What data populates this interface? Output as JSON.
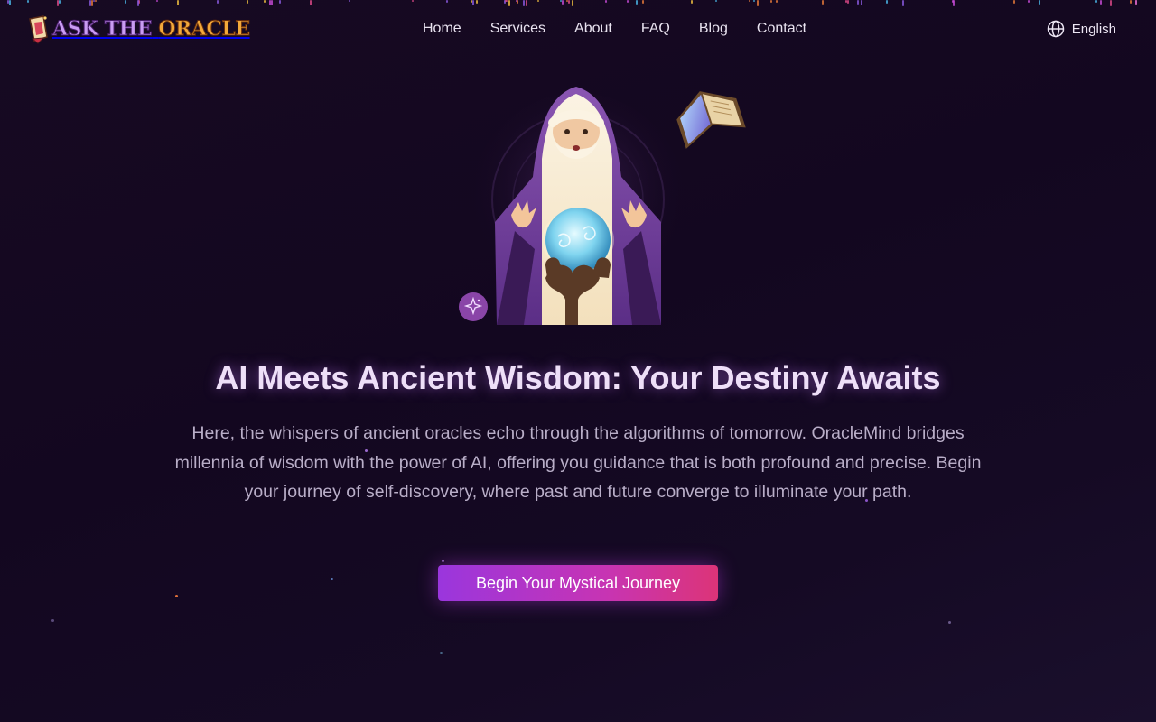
{
  "header": {
    "logo": {
      "word1": "ASK THE",
      "word2": "ORACLE"
    },
    "nav": [
      {
        "label": "Home"
      },
      {
        "label": "Services"
      },
      {
        "label": "About"
      },
      {
        "label": "FAQ"
      },
      {
        "label": "Blog"
      },
      {
        "label": "Contact"
      }
    ],
    "language": {
      "label": "English",
      "icon": "globe-icon"
    }
  },
  "hero": {
    "illustration": "wizard-with-crystal-ball",
    "title": "AI Meets Ancient Wisdom: Your Destiny Awaits",
    "description": "Here, the whispers of ancient oracles echo through the algorithms of tomorrow. OracleMind bridges millennia of wisdom with the power of AI, offering you guidance that is both profound and precise. Begin your journey of self-discovery, where past and future converge to illuminate your path.",
    "cta_label": "Begin Your Mystical Journey"
  },
  "colors": {
    "background": "#150a22",
    "accent_purple": "#9a36dd",
    "accent_pink": "#dc3478",
    "title_glow": "#c478ff"
  }
}
